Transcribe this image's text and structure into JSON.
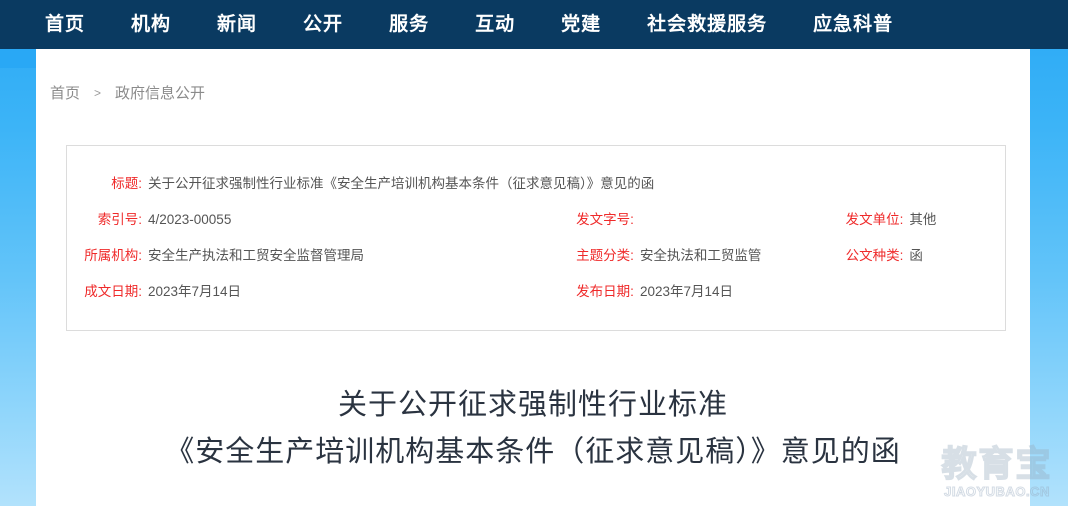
{
  "nav": {
    "items": [
      {
        "label": "首页"
      },
      {
        "label": "机构"
      },
      {
        "label": "新闻"
      },
      {
        "label": "公开"
      },
      {
        "label": "服务"
      },
      {
        "label": "互动"
      },
      {
        "label": "党建"
      },
      {
        "label": "社会救援服务"
      },
      {
        "label": "应急科普"
      }
    ]
  },
  "breadcrumb": {
    "home": "首页",
    "separator": ">",
    "current": "政府信息公开"
  },
  "info": {
    "title_label": "标题:",
    "title_value": "关于公开征求强制性行业标准《安全生产培训机构基本条件（征求意见稿）》意见的函",
    "index_label": "索引号:",
    "index_value": "4/2023-00055",
    "doc_number_label": "发文字号:",
    "doc_number_value": "",
    "issuing_unit_label": "发文单位:",
    "issuing_unit_value": "其他",
    "org_label": "所属机构:",
    "org_value": "安全生产执法和工贸安全监督管理局",
    "topic_label": "主题分类:",
    "topic_value": "安全执法和工贸监管",
    "doc_type_label": "公文种类:",
    "doc_type_value": "函",
    "written_date_label": "成文日期:",
    "written_date_value": "2023年7月14日",
    "publish_date_label": "发布日期:",
    "publish_date_value": "2023年7月14日"
  },
  "document": {
    "title_line1": "关于公开征求强制性行业标准",
    "title_line2": "《安全生产培训机构基本条件（征求意见稿）》意见的函"
  },
  "watermark": {
    "cn": "教育宝",
    "en": "JIAOYUBAO.CN"
  },
  "colors": {
    "nav_background": "#0a3a61",
    "accent_blue": "#29a8f5",
    "label_red": "#ef2a2a",
    "value_gray": "#555555",
    "breadcrumb_gray": "#8b8b8b",
    "doc_title": "#2a3340",
    "box_border": "#dcdcdc"
  }
}
